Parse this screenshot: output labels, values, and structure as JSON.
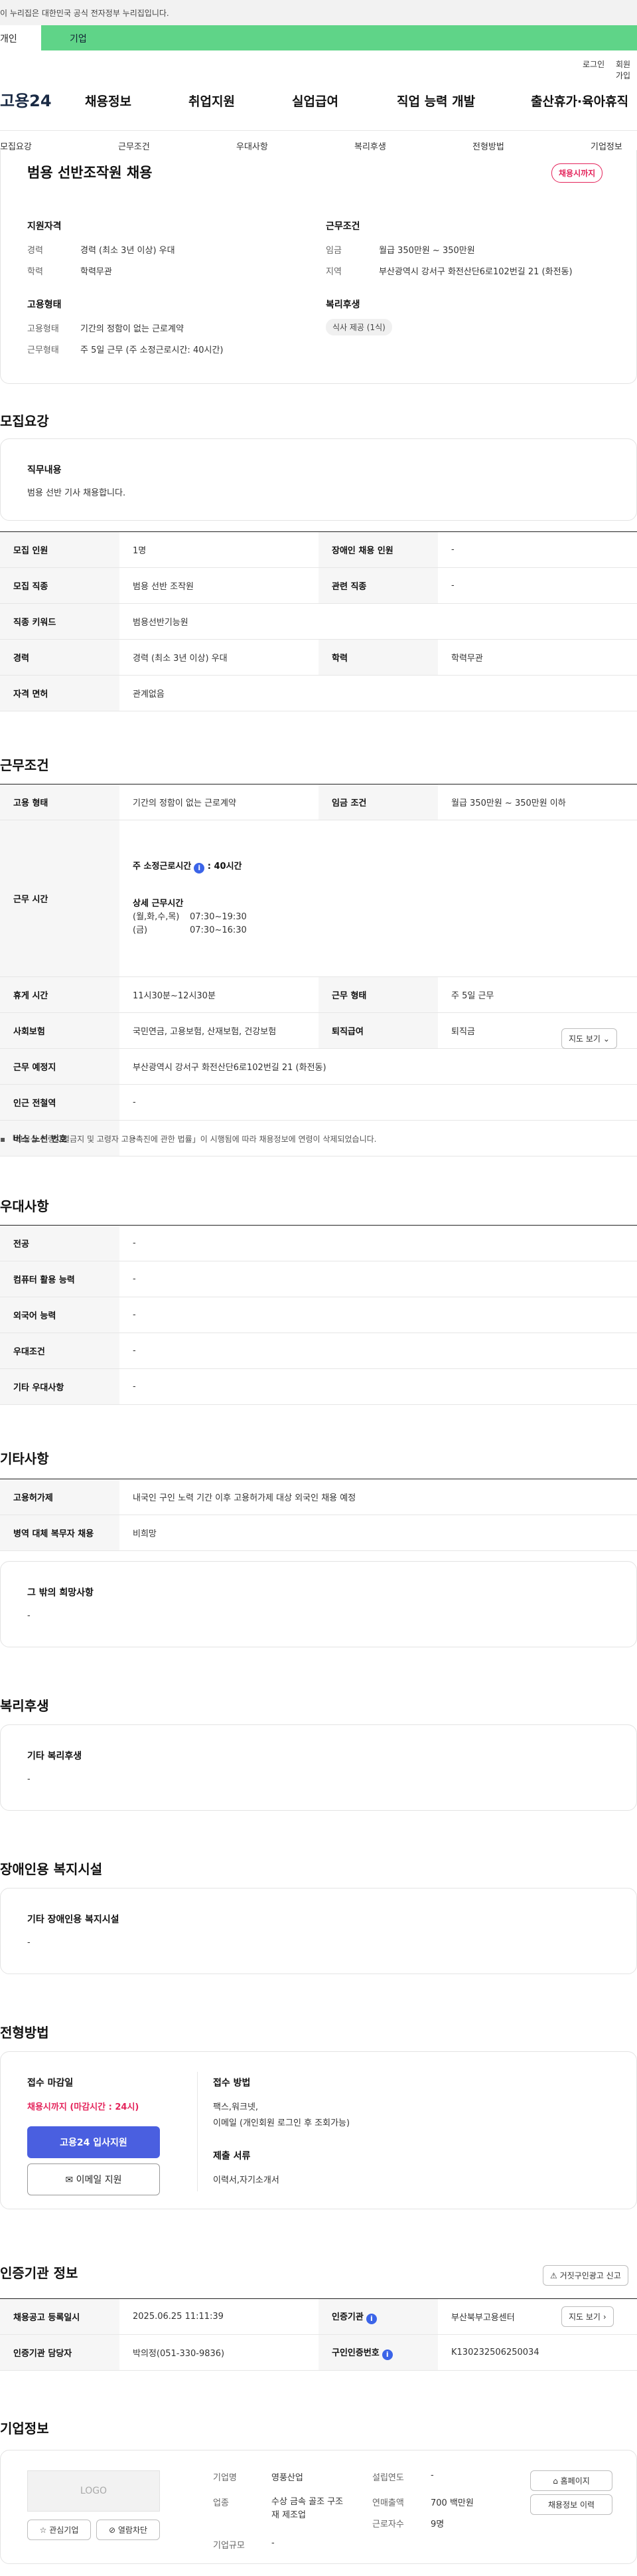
{
  "gov_banner": "이 누리집은 대한민국 공식 전자정부 누리집입니다.",
  "user_tabs": {
    "person": "개인",
    "corp": "기업"
  },
  "util": {
    "login": "로그인",
    "join": "회원가입"
  },
  "logo": "고용24",
  "gnb": [
    "채용정보",
    "취업지원",
    "실업급여",
    "직업 능력 개발",
    "출산휴가·육아휴직"
  ],
  "subnav": [
    "모집요강",
    "근무조건",
    "우대사항",
    "복리후생",
    "전형방법",
    "기업정보"
  ],
  "summary": {
    "title": "범용 선반조작원 채용",
    "status_badge": "채용시까지",
    "qual_heading": "지원자격",
    "career_label": "경력",
    "career_value": "경력 (최소 3년 이상) 우대",
    "edu_label": "학력",
    "edu_value": "학력무관",
    "cond_heading": "근무조건",
    "wage_label": "임금",
    "wage_value": "월급 350만원 ~ 350만원",
    "area_label": "지역",
    "area_value": "부산광역시 강서구 화전산단6로102번길 21 (화전동)",
    "emp_heading": "고용형태",
    "emptype_label": "고용형태",
    "emptype_value": "기간의 정함이 없는 근로계약",
    "worktype_label": "근무형태",
    "worktype_value": "주 5일 근무 (주 소정근로시간: 40시간)",
    "welfare_heading": "복리후생",
    "welfare_chip": "식사 제공 (1식)"
  },
  "recruit": {
    "title": "모집요강",
    "job_heading": "직무내용",
    "job_text": "범용 선반 기사 채용합니다.",
    "headcount_label": "모집 인원",
    "headcount_value": "1명",
    "disabled_label": "장애인 채용 인원",
    "disabled_value": "-",
    "occupation_label": "모집 직종",
    "occupation_value": "범용 선반 조작원",
    "related_label": "관련 직종",
    "related_value": "-",
    "keyword_label": "직종 키워드",
    "keyword_value": "범용선반기능원",
    "career_label": "경력",
    "career_value": "경력 (최소 3년 이상) 우대",
    "edu_label": "학력",
    "edu_value": "학력무관",
    "license_label": "자격 면허",
    "license_value": "관계없음"
  },
  "work": {
    "title": "근무조건",
    "emptype_label": "고용 형태",
    "emptype_value": "기간의 정함이 없는 근로계약",
    "wage_label": "임금 조건",
    "wage_value": "월급 350만원 ~ 350만원 이하",
    "hours_label": "근무 시간",
    "weekly_hours": "주 소정근로시간",
    "weekly_hours_value": ": 40시간",
    "detail_heading": "상세 근무시간",
    "detail_days1": "(월,화,수,목)",
    "detail_time1": "07:30~19:30",
    "detail_days2": "(금)",
    "detail_time2": "07:30~16:30",
    "break_label": "휴게 시간",
    "break_value": "11시30분~12시30분",
    "shift_label": "근무 형태",
    "shift_value": "주 5일 근무",
    "insurance_label": "사회보험",
    "insurance_value": "국민연금, 고용보험, 산재보험, 건강보험",
    "severance_label": "퇴직급여",
    "severance_value": "퇴직금",
    "place_label": "근무 예정지",
    "place_value": "부산광역시 강서구 화전산단6로102번길 21 (화전동)",
    "map_btn": "지도 보기",
    "subway_label": "인근 전철역",
    "subway_value": "-",
    "bus_label": "버스 노선 번호",
    "bus_value": "-",
    "note": "「고용상 연령차별금지 및 고령자 고용촉진에 관한 법률」이 시행됨에 따라 채용정보에 연령이 삭제되었습니다."
  },
  "pref": {
    "title": "우대사항",
    "major_label": "전공",
    "major_value": "-",
    "pc_label": "컴퓨터 활용 능력",
    "pc_value": "-",
    "lang_label": "외국어 능력",
    "lang_value": "-",
    "cond_label": "우대조건",
    "cond_value": "-",
    "other_label": "기타 우대사항",
    "other_value": "-"
  },
  "etc": {
    "title": "기타사항",
    "permit_label": "고용허가제",
    "permit_value": "내국인 구인 노력 기간 이후 고용허가제 대상 외국인 채용 예정",
    "military_label": "병역 대체 복무자 채용",
    "military_value": "비희망",
    "other_heading": "그 밖의 희망사항",
    "other_value": "-"
  },
  "welfare": {
    "title": "복리후생",
    "heading": "기타 복리후생",
    "value": "-"
  },
  "disabled": {
    "title": "장애인용 복지시설",
    "heading": "기타 장애인용 복지시설",
    "value": "-"
  },
  "selection": {
    "title": "전형방법",
    "deadline_heading": "접수 마감일",
    "deadline_value": "채용시까지 (마감시간 : 24시)",
    "apply_btn": "고용24 입사지원",
    "email_btn": "이메일 지원",
    "method_heading": "접수 방법",
    "method_value1": "팩스,워크넷,",
    "method_value2": "이메일 (개인회원 로그인 후 조회가능)",
    "docs_heading": "제출 서류",
    "docs_value": "이력서,자기소개서"
  },
  "cert": {
    "title": "인증기관 정보",
    "report_btn": "거짓구인광고 신고",
    "reg_label": "채용공고 등록일시",
    "reg_value": "2025.06.25 11:11:39",
    "org_label": "인증기관",
    "org_value": "부산북부고용센터",
    "map_btn": "지도 보기",
    "manager_label": "인증기관 담당자",
    "manager_value": "박의정(051-330-9836)",
    "num_label": "구인인증번호",
    "num_value": "K130232506250034"
  },
  "company": {
    "title": "기업정보",
    "logo_text": "LOGO",
    "fav_btn": "관심기업",
    "block_btn": "열람차단",
    "name_label": "기업명",
    "name_value": "영풍산업",
    "industry_label": "업종",
    "industry_value": "수상 금속 골조 구조재 제조업",
    "size_label": "기업규모",
    "size_value": "-",
    "founded_label": "설립연도",
    "founded_value": "-",
    "sales_label": "연매출액",
    "sales_value": "700 백만원",
    "employees_label": "근로자수",
    "employees_value": "9명",
    "homepage_btn": "홈페이지",
    "more_btn": "채용정보 이력"
  },
  "colors": {
    "brand_green": "#5fd488",
    "primary_blue": "#4a5fe0",
    "deadline_red": "#e4245b"
  }
}
